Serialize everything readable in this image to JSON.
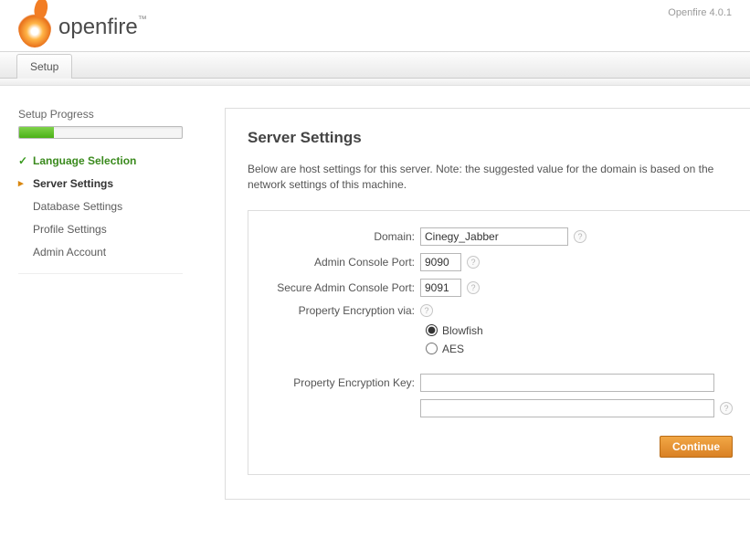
{
  "header": {
    "product_name": "openfire",
    "version_label": "Openfire 4.0.1"
  },
  "tab": {
    "label": "Setup"
  },
  "sidebar": {
    "title": "Setup Progress",
    "steps": [
      {
        "label": "Language Selection",
        "state": "done"
      },
      {
        "label": "Server Settings",
        "state": "current"
      },
      {
        "label": "Database Settings",
        "state": "pending"
      },
      {
        "label": "Profile Settings",
        "state": "pending"
      },
      {
        "label": "Admin Account",
        "state": "pending"
      }
    ]
  },
  "panel": {
    "title": "Server Settings",
    "description": "Below are host settings for this server. Note: the suggested value for the domain is based on the network settings of this machine.",
    "form": {
      "domain_label": "Domain:",
      "domain_value": "Cinegy_Jabber",
      "admin_port_label": "Admin Console Port:",
      "admin_port_value": "9090",
      "secure_port_label": "Secure Admin Console Port:",
      "secure_port_value": "9091",
      "encryption_via_label": "Property Encryption via:",
      "radio_blowfish": "Blowfish",
      "radio_aes": "AES",
      "encryption_key_label": "Property Encryption Key:",
      "encryption_key_value": "",
      "encryption_key_value2": ""
    },
    "continue_label": "Continue"
  },
  "icons": {
    "help": "?"
  }
}
